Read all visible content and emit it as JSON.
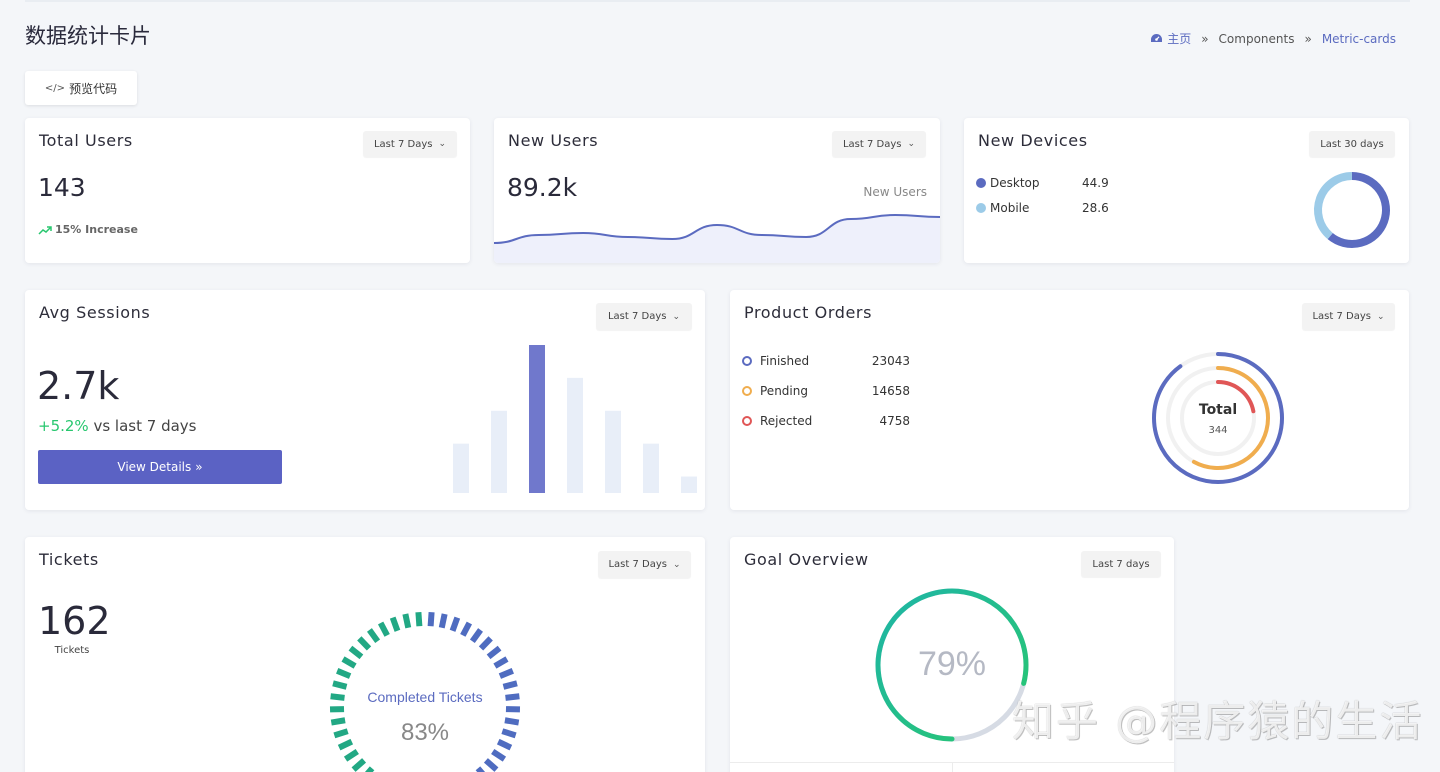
{
  "page": {
    "title": "数据统计卡片",
    "preview_button": "预览代码"
  },
  "breadcrumb": {
    "home": "主页",
    "items": [
      "Components",
      "Metric-cards"
    ]
  },
  "total_users": {
    "title": "Total Users",
    "range": "Last 7 Days",
    "value": "143",
    "change": "15% Increase"
  },
  "new_users": {
    "title": "New Users",
    "range": "Last 7 Days",
    "value": "89.2k",
    "series_label": "New Users",
    "trend_values": [
      20,
      28,
      30,
      26,
      24,
      38,
      28,
      26,
      44,
      48,
      46
    ]
  },
  "new_devices": {
    "title": "New Devices",
    "range": "Last 30 days",
    "items": [
      {
        "label": "Desktop",
        "value": "44.9",
        "color": "#5b6bc0"
      },
      {
        "label": "Mobile",
        "value": "28.6",
        "color": "#9ccbe8"
      }
    ]
  },
  "avg_sessions": {
    "title": "Avg Sessions",
    "range": "Last 7 Days",
    "value": "2.7k",
    "change": "+5.2%",
    "change_suffix": "vs last 7 days",
    "button": "View Details",
    "bars": [
      30,
      50,
      90,
      70,
      50,
      30,
      10
    ],
    "highlight_index": 2
  },
  "product_orders": {
    "title": "Product Orders",
    "range": "Last 7 Days",
    "items": [
      {
        "label": "Finished",
        "value": "23043",
        "color": "#5b6bc0"
      },
      {
        "label": "Pending",
        "value": "14658",
        "color": "#f0ad4e"
      },
      {
        "label": "Rejected",
        "value": "4758",
        "color": "#e05656"
      }
    ],
    "center_label": "Total",
    "center_value": "344"
  },
  "tickets": {
    "title": "Tickets",
    "range": "Last 7 Days",
    "value": "162",
    "value_label": "Tickets",
    "gauge_label": "Completed Tickets",
    "gauge_value": "83%"
  },
  "goal_overview": {
    "title": "Goal Overview",
    "range": "Last 7 days",
    "value": "79%",
    "progress": 0.79
  },
  "watermark": "知乎 @程序猿的生活",
  "colors": {
    "primary": "#5b62c4",
    "success": "#28c76f",
    "teal": "#1fb5a6"
  }
}
